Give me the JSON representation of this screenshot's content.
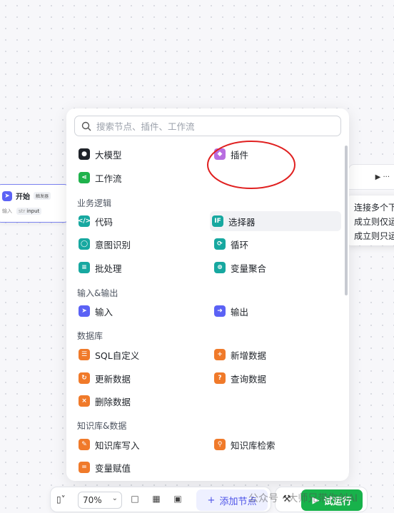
{
  "search": {
    "placeholder": "搜索节点、插件、工作流"
  },
  "top_items": [
    {
      "label": "大模型",
      "icon": "model-icon",
      "color": "#1f2329"
    },
    {
      "label": "插件",
      "icon": "plugin-icon",
      "color": "#b86de0"
    },
    {
      "label": "工作流",
      "icon": "workflow-icon",
      "color": "#1fb24c"
    }
  ],
  "sections": [
    {
      "title": "业务逻辑",
      "items": [
        {
          "label": "代码",
          "icon": "code-icon",
          "color": "#17a8a0"
        },
        {
          "label": "选择器",
          "icon": "if-icon",
          "color": "#17a8a0",
          "glyph": "IF"
        },
        {
          "label": "意图识别",
          "icon": "intent-icon",
          "color": "#17a8a0"
        },
        {
          "label": "循环",
          "icon": "loop-icon",
          "color": "#17a8a0"
        },
        {
          "label": "批处理",
          "icon": "batch-icon",
          "color": "#17a8a0"
        },
        {
          "label": "变量聚合",
          "icon": "aggregate-icon",
          "color": "#17a8a0"
        }
      ]
    },
    {
      "title": "输入&输出",
      "items": [
        {
          "label": "输入",
          "icon": "input-icon",
          "color": "#5b62f5"
        },
        {
          "label": "输出",
          "icon": "output-icon",
          "color": "#5b62f5"
        }
      ]
    },
    {
      "title": "数据库",
      "items": [
        {
          "label": "SQL自定义",
          "icon": "sql-icon",
          "color": "#f07a2a"
        },
        {
          "label": "新增数据",
          "icon": "db-add-icon",
          "color": "#f07a2a"
        },
        {
          "label": "更新数据",
          "icon": "db-update-icon",
          "color": "#f07a2a"
        },
        {
          "label": "查询数据",
          "icon": "db-query-icon",
          "color": "#f07a2a"
        },
        {
          "label": "删除数据",
          "icon": "db-delete-icon",
          "color": "#f07a2a"
        }
      ]
    },
    {
      "title": "知识库&数据",
      "items": [
        {
          "label": "知识库写入",
          "icon": "kb-write-icon",
          "color": "#f07a2a"
        },
        {
          "label": "知识库检索",
          "icon": "kb-search-icon",
          "color": "#f07a2a"
        },
        {
          "label": "变量赋值",
          "icon": "var-assign-icon",
          "color": "#f07a2a"
        }
      ]
    }
  ],
  "start_node": {
    "title": "开始",
    "badge": "触发器",
    "row_label": "输入",
    "param_type": "str",
    "param_name": "input"
  },
  "tooltip": {
    "lines": [
      "连接多个下",
      "成立则仅运",
      "成立则只运"
    ]
  },
  "toolbar": {
    "zoom": "70%",
    "add_label": "添加节点",
    "run_label": "试运行"
  },
  "watermark": "公众号 · 大师兄带你创AI",
  "highlight_color": "#e02020"
}
